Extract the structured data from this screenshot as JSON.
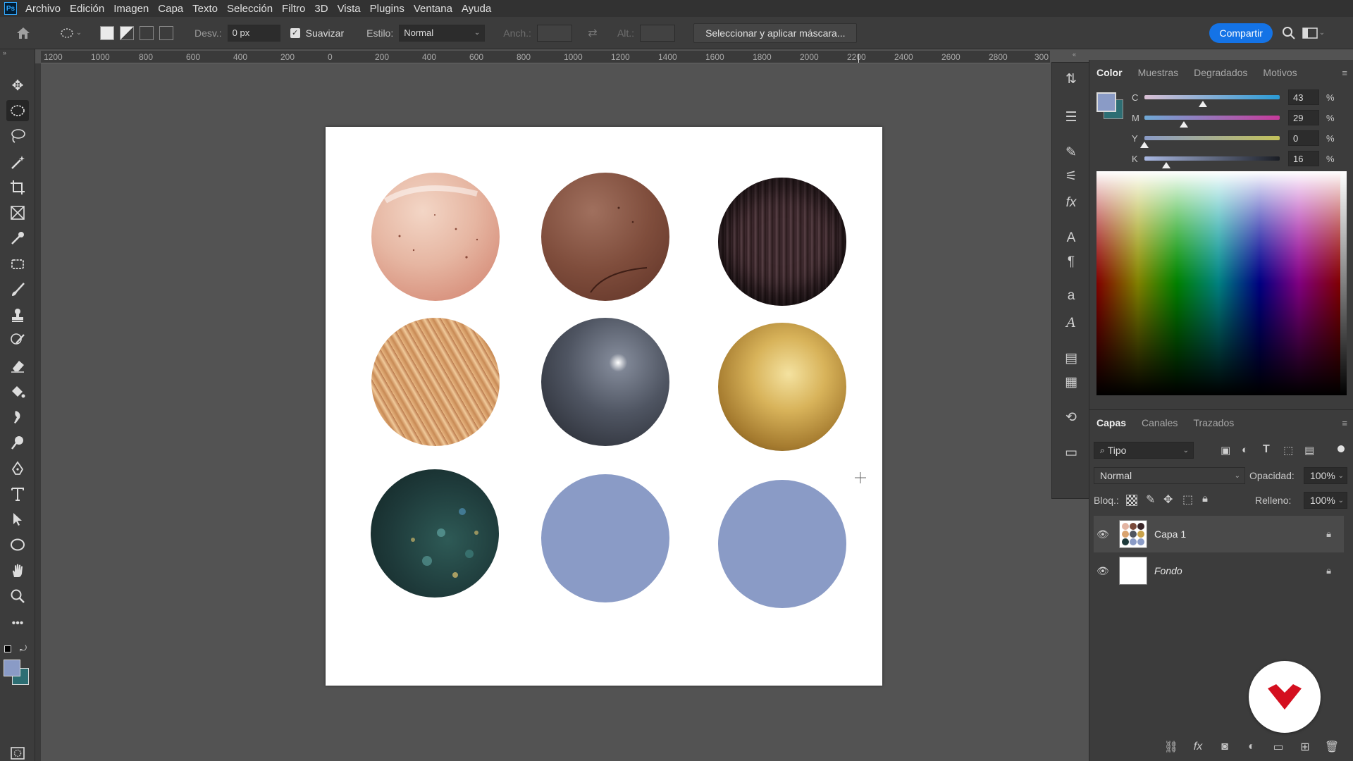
{
  "menu": [
    "Archivo",
    "Edición",
    "Imagen",
    "Capa",
    "Texto",
    "Selección",
    "Filtro",
    "3D",
    "Vista",
    "Plugins",
    "Ventana",
    "Ayuda"
  ],
  "options": {
    "desv_label": "Desv.:",
    "desv_value": "0 px",
    "suavizar_label": "Suavizar",
    "estilo_label": "Estilo:",
    "estilo_value": "Normal",
    "anch_label": "Anch.:",
    "alt_label": "Alt.:",
    "mask_button": "Seleccionar y aplicar máscara...",
    "share_button": "Compartir"
  },
  "ruler": [
    "1200",
    "1000",
    "800",
    "600",
    "400",
    "200",
    "0",
    "200",
    "400",
    "600",
    "800",
    "1000",
    "1200",
    "1400",
    "1600",
    "1800",
    "2000",
    "2200",
    "2400",
    "2600",
    "2800",
    "300"
  ],
  "color_panel": {
    "tabs": [
      "Color",
      "Muestras",
      "Degradados",
      "Motivos"
    ],
    "foreground": "#8a9bc6",
    "background": "#2d6e73",
    "cmyk": [
      {
        "letter": "C",
        "value": "43",
        "pct": "%",
        "level": 0.43
      },
      {
        "letter": "M",
        "value": "29",
        "pct": "%",
        "level": 0.29
      },
      {
        "letter": "Y",
        "value": "0",
        "pct": "%",
        "level": 0.0
      },
      {
        "letter": "K",
        "value": "16",
        "pct": "%",
        "level": 0.16
      }
    ]
  },
  "layers_panel": {
    "tabs": [
      "Capas",
      "Canales",
      "Trazados"
    ],
    "filter_value": "Tipo",
    "blend_mode": "Normal",
    "opacity_label": "Opacidad:",
    "opacity_value": "100%",
    "lock_label": "Bloq.:",
    "fill_label": "Relleno:",
    "fill_value": "100%",
    "layers": [
      {
        "name": "Capa 1",
        "selected": true
      },
      {
        "name": "Fondo",
        "selected": false
      }
    ]
  },
  "circle_colors": {
    "skin": "#e3b4a2",
    "chocolate": "#7a4a3a",
    "dark_hair": "#3a2628",
    "blonde_hair": "#d9a36e",
    "pearl": "#505560",
    "gold": "#c9a24a",
    "foliage": "#1e3a3a",
    "plain_blue": "#8a9bc6"
  }
}
